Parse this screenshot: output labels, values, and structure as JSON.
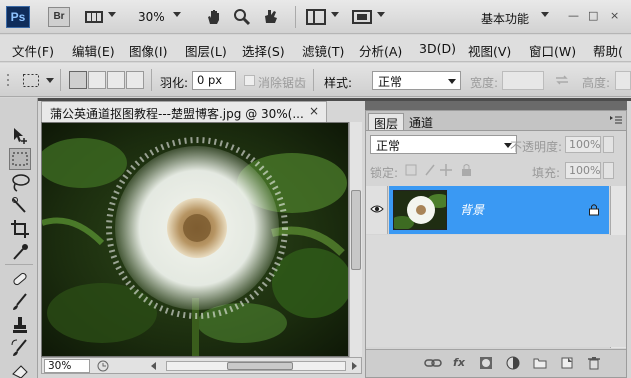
{
  "app": {
    "logo": "Ps",
    "bridge_label": "Br",
    "zoom": "30%",
    "workspace": "基本功能",
    "window_buttons": [
      "—",
      "□",
      "×"
    ]
  },
  "menu": [
    "文件(F)",
    "编辑(E)",
    "图像(I)",
    "图层(L)",
    "选择(S)",
    "滤镜(T)",
    "分析(A)",
    "3D(D)",
    "视图(V)",
    "窗口(W)",
    "帮助("
  ],
  "options": {
    "feather_label": "羽化:",
    "feather_value": "0 px",
    "antialias_label": "消除锯齿",
    "style_label": "样式:",
    "style_value": "正常",
    "width_label": "宽度:",
    "height_label": "高度:"
  },
  "document": {
    "tab_title": "蒲公英通道抠图教程---楚盟博客.jpg @ 30%(...",
    "close_glyph": "×",
    "zoom_field": "30%"
  },
  "layers_panel": {
    "tabs": [
      "图层",
      "通道"
    ],
    "blend_mode": "正常",
    "opacity_label": "不透明度:",
    "opacity_value": "100%",
    "lock_label": "锁定:",
    "fill_label": "填充:",
    "fill_value": "100%",
    "layer_name": "背景",
    "footer_icons": [
      "link-icon",
      "fx-icon",
      "mask-icon",
      "adjustment-icon",
      "folder-icon",
      "new-layer-icon",
      "trash-icon"
    ]
  },
  "colors": {
    "selection_blue": "#3a99f3",
    "ps_logo_bg": "#0f2d5b"
  }
}
